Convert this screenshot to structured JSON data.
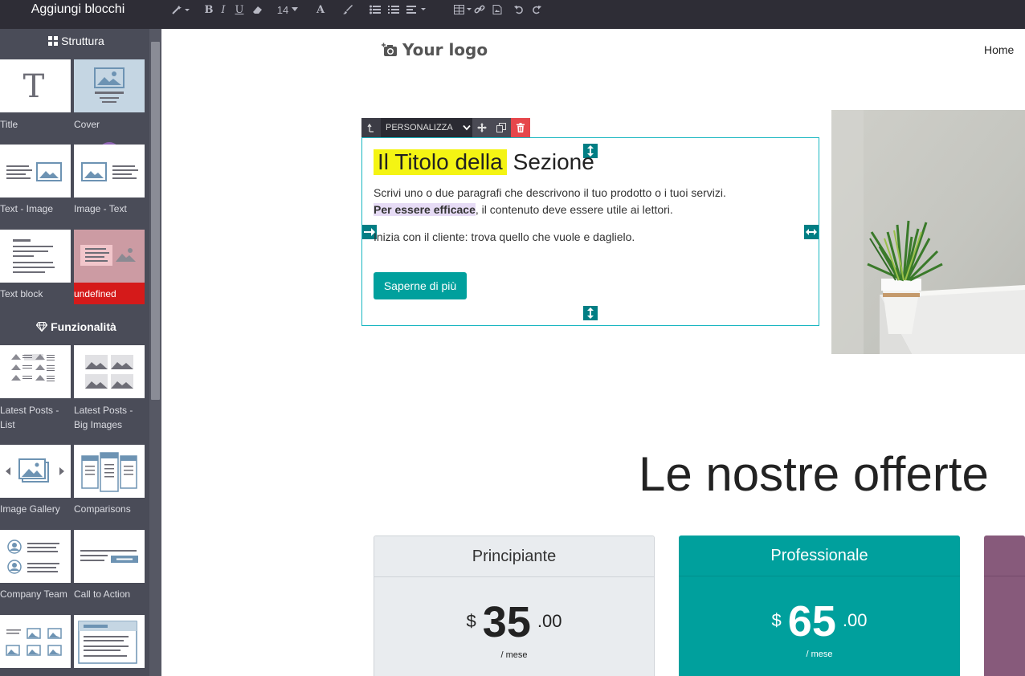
{
  "sidebar": {
    "title": "Aggiungi blocchi",
    "sections": {
      "structure": "Struttura",
      "features": "Funzionalità"
    },
    "blocks": [
      {
        "label": "Title",
        "icon": "title-block-icon"
      },
      {
        "label": "Cover",
        "icon": "cover-block-icon"
      },
      {
        "label": "Text - Image",
        "icon": "text-image-block-icon"
      },
      {
        "label": "Image - Text",
        "icon": "image-text-block-icon"
      },
      {
        "label": "Text block",
        "icon": "text-block-icon"
      },
      {
        "label": "undefined",
        "icon": "undefined-block-icon"
      },
      {
        "label": "Latest Posts - List",
        "icon": "latest-posts-list-icon"
      },
      {
        "label": "Latest Posts - Big Images",
        "icon": "latest-posts-big-images-icon"
      },
      {
        "label": "Image Gallery",
        "icon": "image-gallery-icon"
      },
      {
        "label": "Comparisons",
        "icon": "comparisons-icon"
      },
      {
        "label": "Company Team",
        "icon": "company-team-icon"
      },
      {
        "label": "Call to Action",
        "icon": "call-to-action-icon"
      }
    ]
  },
  "toolbar": {
    "font_size": "14"
  },
  "header": {
    "logo_text": "Your logo",
    "nav_home": "Home"
  },
  "editor": {
    "customize_label": "PERSONALIZZA"
  },
  "section": {
    "title_highlight": "Il Titolo della",
    "title_rest": "Sezione",
    "paragraph1": "Scrivi uno o due paragrafi che descrivono il tuo prodotto o i tuoi servizi.",
    "paragraph1_bold": "Per essere efficace",
    "paragraph1_rest": ", il contenuto deve essere utile ai lettori.",
    "paragraph2": "Inizia con il cliente: trova quello che vuole e daglielo.",
    "button": "Saperne di più"
  },
  "offers": {
    "title": "Le nostre offerte",
    "plans": [
      {
        "name": "Principiante",
        "currency": "$",
        "price": "35",
        "decimals": ".00",
        "period": "/ mese"
      },
      {
        "name": "Professionale",
        "currency": "$",
        "price": "65",
        "decimals": ".00",
        "period": "/ mese"
      }
    ]
  },
  "colors": {
    "primary": "#00a09d",
    "topbar": "#2e2d36",
    "sidebar": "#4a4c58",
    "selection": "#19b6c1",
    "highlight": "#f4f413",
    "purple_card": "#875a7b"
  }
}
